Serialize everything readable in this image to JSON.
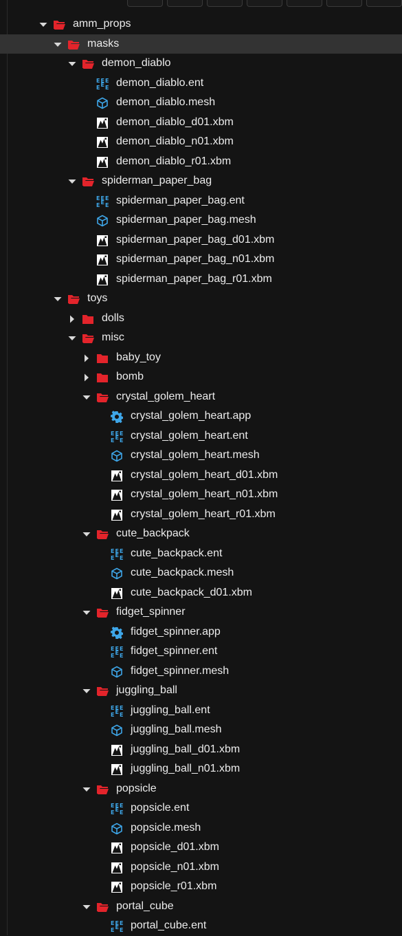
{
  "colors": {
    "folder": "#e3242b",
    "accent": "#3ea6e8",
    "selected": "#333333"
  },
  "tree": [
    {
      "label": "amm_props",
      "level": 0,
      "kind": "folder",
      "expanded": true
    },
    {
      "label": "masks",
      "level": 1,
      "kind": "folder",
      "expanded": true,
      "selected": true
    },
    {
      "label": "demon_diablo",
      "level": 2,
      "kind": "folder",
      "expanded": true
    },
    {
      "label": "demon_diablo.ent",
      "level": 3,
      "kind": "ent"
    },
    {
      "label": "demon_diablo.mesh",
      "level": 3,
      "kind": "mesh"
    },
    {
      "label": "demon_diablo_d01.xbm",
      "level": 3,
      "kind": "xbm"
    },
    {
      "label": "demon_diablo_n01.xbm",
      "level": 3,
      "kind": "xbm"
    },
    {
      "label": "demon_diablo_r01.xbm",
      "level": 3,
      "kind": "xbm"
    },
    {
      "label": "spiderman_paper_bag",
      "level": 2,
      "kind": "folder",
      "expanded": true
    },
    {
      "label": "spiderman_paper_bag.ent",
      "level": 3,
      "kind": "ent"
    },
    {
      "label": "spiderman_paper_bag.mesh",
      "level": 3,
      "kind": "mesh"
    },
    {
      "label": "spiderman_paper_bag_d01.xbm",
      "level": 3,
      "kind": "xbm"
    },
    {
      "label": "spiderman_paper_bag_n01.xbm",
      "level": 3,
      "kind": "xbm"
    },
    {
      "label": "spiderman_paper_bag_r01.xbm",
      "level": 3,
      "kind": "xbm"
    },
    {
      "label": "toys",
      "level": 1,
      "kind": "folder",
      "expanded": true
    },
    {
      "label": "dolls",
      "level": 2,
      "kind": "folder",
      "expanded": false
    },
    {
      "label": "misc",
      "level": 2,
      "kind": "folder",
      "expanded": true
    },
    {
      "label": "baby_toy",
      "level": 3,
      "kind": "folder",
      "expanded": false
    },
    {
      "label": "bomb",
      "level": 3,
      "kind": "folder",
      "expanded": false
    },
    {
      "label": "crystal_golem_heart",
      "level": 3,
      "kind": "folder",
      "expanded": true
    },
    {
      "label": "crystal_golem_heart.app",
      "level": 4,
      "kind": "app"
    },
    {
      "label": "crystal_golem_heart.ent",
      "level": 4,
      "kind": "ent"
    },
    {
      "label": "crystal_golem_heart.mesh",
      "level": 4,
      "kind": "mesh"
    },
    {
      "label": "crystal_golem_heart_d01.xbm",
      "level": 4,
      "kind": "xbm"
    },
    {
      "label": "crystal_golem_heart_n01.xbm",
      "level": 4,
      "kind": "xbm"
    },
    {
      "label": "crystal_golem_heart_r01.xbm",
      "level": 4,
      "kind": "xbm"
    },
    {
      "label": "cute_backpack",
      "level": 3,
      "kind": "folder",
      "expanded": true
    },
    {
      "label": "cute_backpack.ent",
      "level": 4,
      "kind": "ent"
    },
    {
      "label": "cute_backpack.mesh",
      "level": 4,
      "kind": "mesh"
    },
    {
      "label": "cute_backpack_d01.xbm",
      "level": 4,
      "kind": "xbm"
    },
    {
      "label": "fidget_spinner",
      "level": 3,
      "kind": "folder",
      "expanded": true
    },
    {
      "label": "fidget_spinner.app",
      "level": 4,
      "kind": "app"
    },
    {
      "label": "fidget_spinner.ent",
      "level": 4,
      "kind": "ent"
    },
    {
      "label": "fidget_spinner.mesh",
      "level": 4,
      "kind": "mesh"
    },
    {
      "label": "juggling_ball",
      "level": 3,
      "kind": "folder",
      "expanded": true
    },
    {
      "label": "juggling_ball.ent",
      "level": 4,
      "kind": "ent"
    },
    {
      "label": "juggling_ball.mesh",
      "level": 4,
      "kind": "mesh"
    },
    {
      "label": "juggling_ball_d01.xbm",
      "level": 4,
      "kind": "xbm"
    },
    {
      "label": "juggling_ball_n01.xbm",
      "level": 4,
      "kind": "xbm"
    },
    {
      "label": "popsicle",
      "level": 3,
      "kind": "folder",
      "expanded": true
    },
    {
      "label": "popsicle.ent",
      "level": 4,
      "kind": "ent"
    },
    {
      "label": "popsicle.mesh",
      "level": 4,
      "kind": "mesh"
    },
    {
      "label": "popsicle_d01.xbm",
      "level": 4,
      "kind": "xbm"
    },
    {
      "label": "popsicle_n01.xbm",
      "level": 4,
      "kind": "xbm"
    },
    {
      "label": "popsicle_r01.xbm",
      "level": 4,
      "kind": "xbm"
    },
    {
      "label": "portal_cube",
      "level": 3,
      "kind": "folder",
      "expanded": true
    },
    {
      "label": "portal_cube.ent",
      "level": 4,
      "kind": "ent"
    }
  ]
}
